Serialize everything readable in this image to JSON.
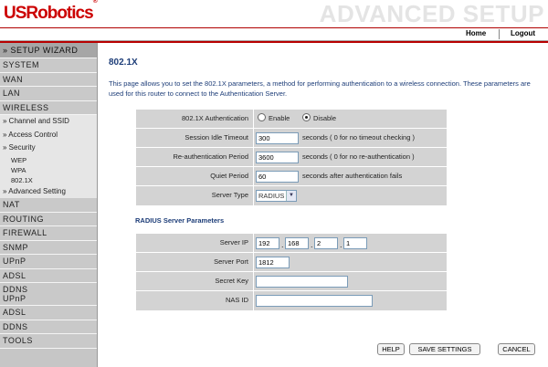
{
  "header": {
    "logo": "USRobotics",
    "logo_mark": "®",
    "banner": "ADVANCED SETUP",
    "home": "Home",
    "logout": "Logout"
  },
  "sidebar": {
    "wizard": "» SETUP WIZARD",
    "top_items": [
      "SYSTEM",
      "WAN",
      "LAN",
      "WIRELESS"
    ],
    "wireless_sub": {
      "channel": "» Channel and SSID",
      "access": "» Access Control",
      "security": "» Security",
      "security_items": [
        "WEP",
        "WPA",
        "802.1X"
      ],
      "advanced": "» Advanced Setting"
    },
    "bottom_items": [
      "NAT",
      "ROUTING",
      "FIREWALL",
      "SNMP",
      "UPnP",
      "ADSL"
    ],
    "ddns_upnp": [
      "DDNS",
      "UPnP"
    ],
    "tail_items": [
      "ADSL",
      "DDNS",
      "TOOLS"
    ]
  },
  "main": {
    "title": "802.1X",
    "description": "This page allows you to set the 802.1X parameters, a method for performing authentication to a wireless connection.  These parameters are used for this router to connect to the Authentication Server.",
    "auth_label": "802.1X Authentication",
    "enable_label": "Enable",
    "disable_label": "Disable",
    "idle_label": "Session Idle Timeout",
    "idle_value": "300",
    "idle_note": "seconds ( 0 for no timeout checking )",
    "reauth_label": "Re-authentication Period",
    "reauth_value": "3600",
    "reauth_note": "seconds ( 0 for no re-authentication )",
    "quiet_label": "Quiet Period",
    "quiet_value": "60",
    "quiet_note": "seconds after authentication fails",
    "server_type_label": "Server Type",
    "server_type_value": "RADIUS",
    "radius_title": "RADIUS Server Parameters",
    "server_ip_label": "Server IP",
    "server_ip": [
      "192",
      "168",
      "2",
      "1"
    ],
    "ip_dot": ".",
    "server_port_label": "Server Port",
    "server_port_value": "1812",
    "secret_label": "Secret Key",
    "secret_value": "",
    "nasid_label": "NAS ID",
    "nasid_value": ""
  },
  "buttons": {
    "help": "HELP",
    "save": "SAVE SETTINGS",
    "cancel": "CANCEL"
  },
  "colors": {
    "brand": "#cc0000",
    "title": "#1d3d78",
    "sidebar": "#c6c6c6",
    "form_bg": "#d3d3d3"
  }
}
